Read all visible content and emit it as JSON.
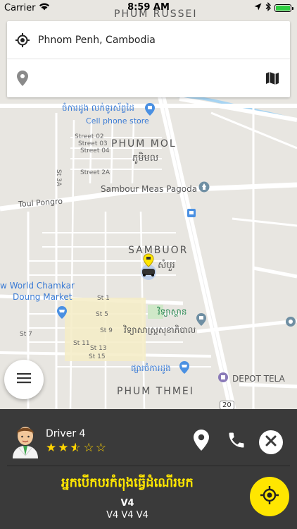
{
  "status_bar": {
    "carrier": "Carrier",
    "time": "8:59 AM"
  },
  "search": {
    "pickup_value": "Phnom Penh, Cambodia",
    "destination_value": "",
    "destination_placeholder": ""
  },
  "map": {
    "labels": {
      "phum_russei": "PHUM RUSSEI",
      "cell_phone_store_km": "ចំការដូង លក់ទូរស័ព្ទដៃ",
      "cell_phone_store": "Cell phone store",
      "street02": "Street 02",
      "street03": "Street 03",
      "street04": "Street 04",
      "street2a": "Street 2A",
      "st3a": "St 3A",
      "phum_mol": "PHUM MOL",
      "phum_mol_km": "ភូមិមល",
      "sambour_meas": "Sambour Meas Pagoda",
      "toul_pongro": "Toul Pongro",
      "sambuor": "SAMBUOR",
      "sambuor_km": "សំបួរ",
      "world_chamkar": "w World Chamkar",
      "doung_market": "Doung Market",
      "st1": "St 1",
      "st5": "St 5",
      "st7": "St 7",
      "st9": "St 9",
      "st11": "St 11",
      "st13": "St 13",
      "st15": "St 15",
      "temple_km": "វិទ្យាស្ថាន",
      "university_km": "វិទ្យាសាស្ត្រសុខាភិបាល",
      "market_km": "ផ្សារចំការដូង",
      "depot_tela": "DEPOT TELA",
      "phum_thmei": "PHUM THMEI",
      "route_badge": "20"
    }
  },
  "driver": {
    "name": "Driver 4",
    "rating": 2.5,
    "rating_max": 5,
    "status_text": "អ្នកបើកបរកំពុងធ្វើដំណើរមក",
    "plate": "V4",
    "car_model": "V4 V4 V4"
  },
  "colors": {
    "accent": "#ffe600",
    "panel_bg": "#3a3a3a",
    "map_bg": "#e8e6e1",
    "water": "#a7d4f2",
    "road": "#ffffff",
    "star": "#ffd400"
  }
}
